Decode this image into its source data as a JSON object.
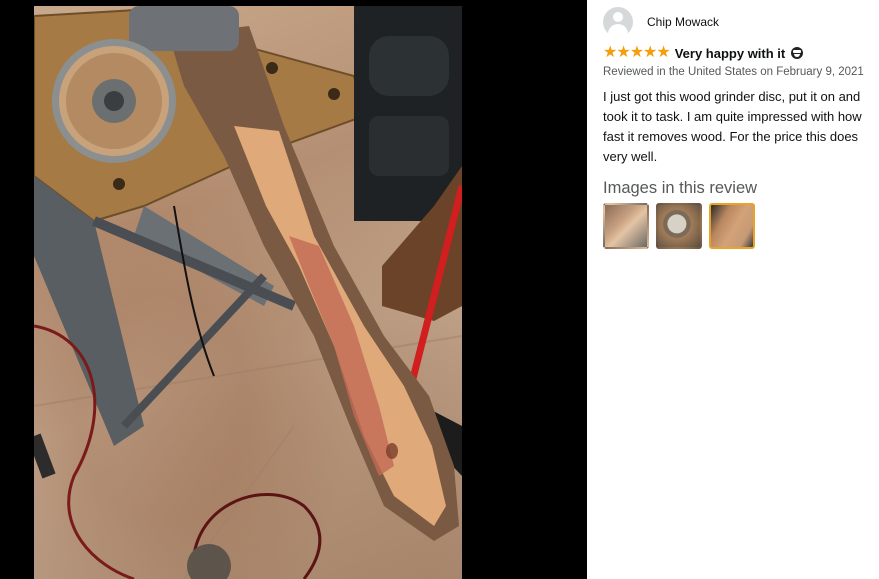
{
  "review": {
    "reviewer_name": "Chip Mowack",
    "rating": 5,
    "title": "Very happy with it",
    "title_emoji": "grinning-face-icon",
    "date": "Reviewed in the United States on February 9, 2021",
    "body": "I just got this wood grinder disc, put it on and took it to task. I am quite impressed with how fast it removes wood. For the price this does very well.",
    "images_heading": "Images in this review",
    "thumbnails": [
      {
        "name": "thumbnail-1",
        "selected": false
      },
      {
        "name": "thumbnail-2",
        "selected": false
      },
      {
        "name": "thumbnail-3",
        "selected": true
      }
    ]
  },
  "colors": {
    "star": "#f49e0c",
    "selected_border": "#e7a32a",
    "muted_text": "#565959",
    "viewer_background": "#000000"
  }
}
